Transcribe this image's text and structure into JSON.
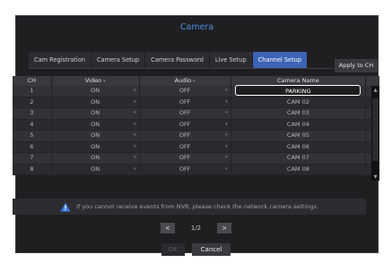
{
  "title": "Camera",
  "tabs": [
    {
      "label": "Cam Registration",
      "active": false
    },
    {
      "label": "Camera Setup",
      "active": false
    },
    {
      "label": "Camera Password",
      "active": false
    },
    {
      "label": "Live Setup",
      "active": false
    },
    {
      "label": "Channel Setup",
      "active": true
    }
  ],
  "apply_label": "Apply to CH",
  "columns": {
    "ch": "CH",
    "video": "Video",
    "audio": "Audio",
    "name": "Camera Name"
  },
  "rows": [
    {
      "ch": "1",
      "video": "ON",
      "audio": "OFF",
      "name": "PARKING",
      "editing": true
    },
    {
      "ch": "2",
      "video": "ON",
      "audio": "OFF",
      "name": "CAM 02"
    },
    {
      "ch": "3",
      "video": "ON",
      "audio": "OFF",
      "name": "CAM 03"
    },
    {
      "ch": "4",
      "video": "ON",
      "audio": "OFF",
      "name": "CAM 04"
    },
    {
      "ch": "5",
      "video": "ON",
      "audio": "OFF",
      "name": "CAM 05"
    },
    {
      "ch": "6",
      "video": "ON",
      "audio": "OFF",
      "name": "CAM 06"
    },
    {
      "ch": "7",
      "video": "ON",
      "audio": "OFF",
      "name": "CAM 07"
    },
    {
      "ch": "8",
      "video": "ON",
      "audio": "OFF",
      "name": "CAM 08"
    }
  ],
  "notice": "If you cannot receive events from NVR, please check the network camera settings.",
  "pager": {
    "prev": "<",
    "page": "1/2",
    "next": ">"
  },
  "footer": {
    "ok": "OK",
    "cancel": "Cancel"
  },
  "colors": {
    "accent": "#3c63b5",
    "title": "#4f8fd9",
    "warning": "#3b7be0"
  },
  "icons": {
    "warning": "warning-icon",
    "dropdown": "chevron-down-icon"
  }
}
